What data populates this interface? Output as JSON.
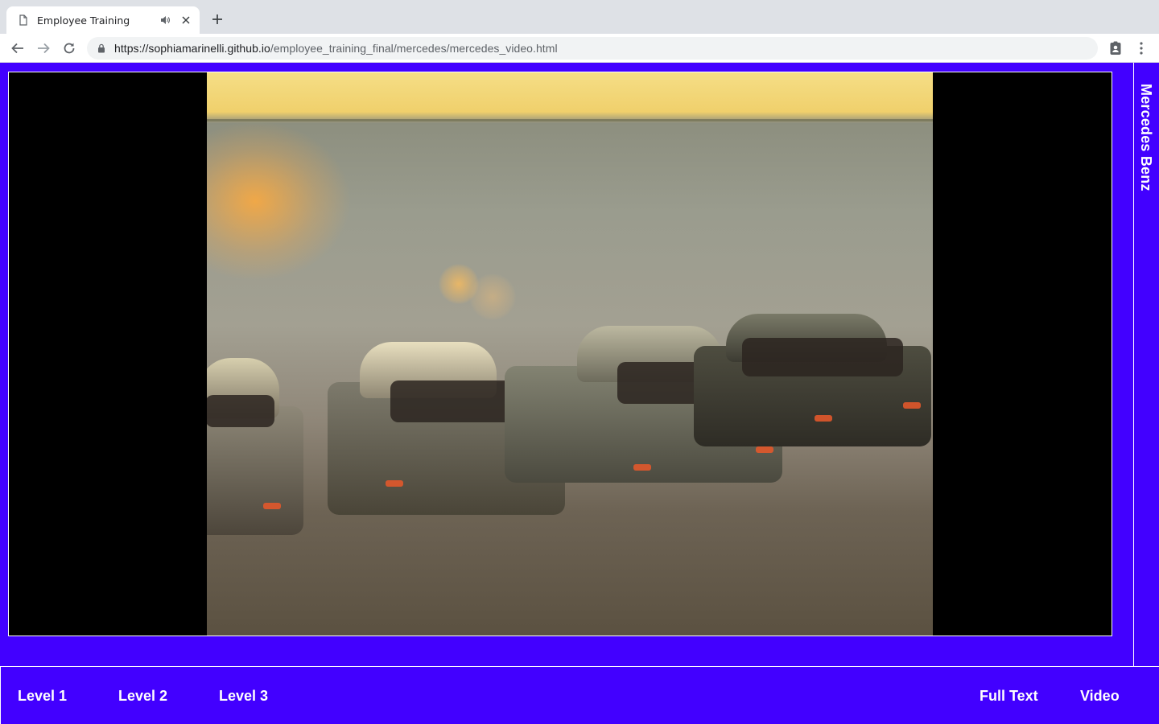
{
  "browser": {
    "tab_title": "Employee Training",
    "url_domain": "https://sophiamarinelli.github.io",
    "url_path": "/employee_training_final/mercedes/mercedes_video.html"
  },
  "page": {
    "background_color": "#4200ff",
    "side_title": "Mercedes Benz",
    "nav": {
      "level1": "Level 1",
      "level2": "Level 2",
      "level3": "Level 3",
      "full_text": "Full Text",
      "video": "Video"
    }
  },
  "icons": {
    "favicon": "document-icon",
    "audio": "speaker-icon",
    "close": "close-icon",
    "new_tab": "plus-icon",
    "back": "arrow-left-icon",
    "forward": "arrow-right-icon",
    "reload": "reload-icon",
    "lock": "lock-icon",
    "extension": "badge-icon",
    "menu": "kebab-menu-icon"
  }
}
